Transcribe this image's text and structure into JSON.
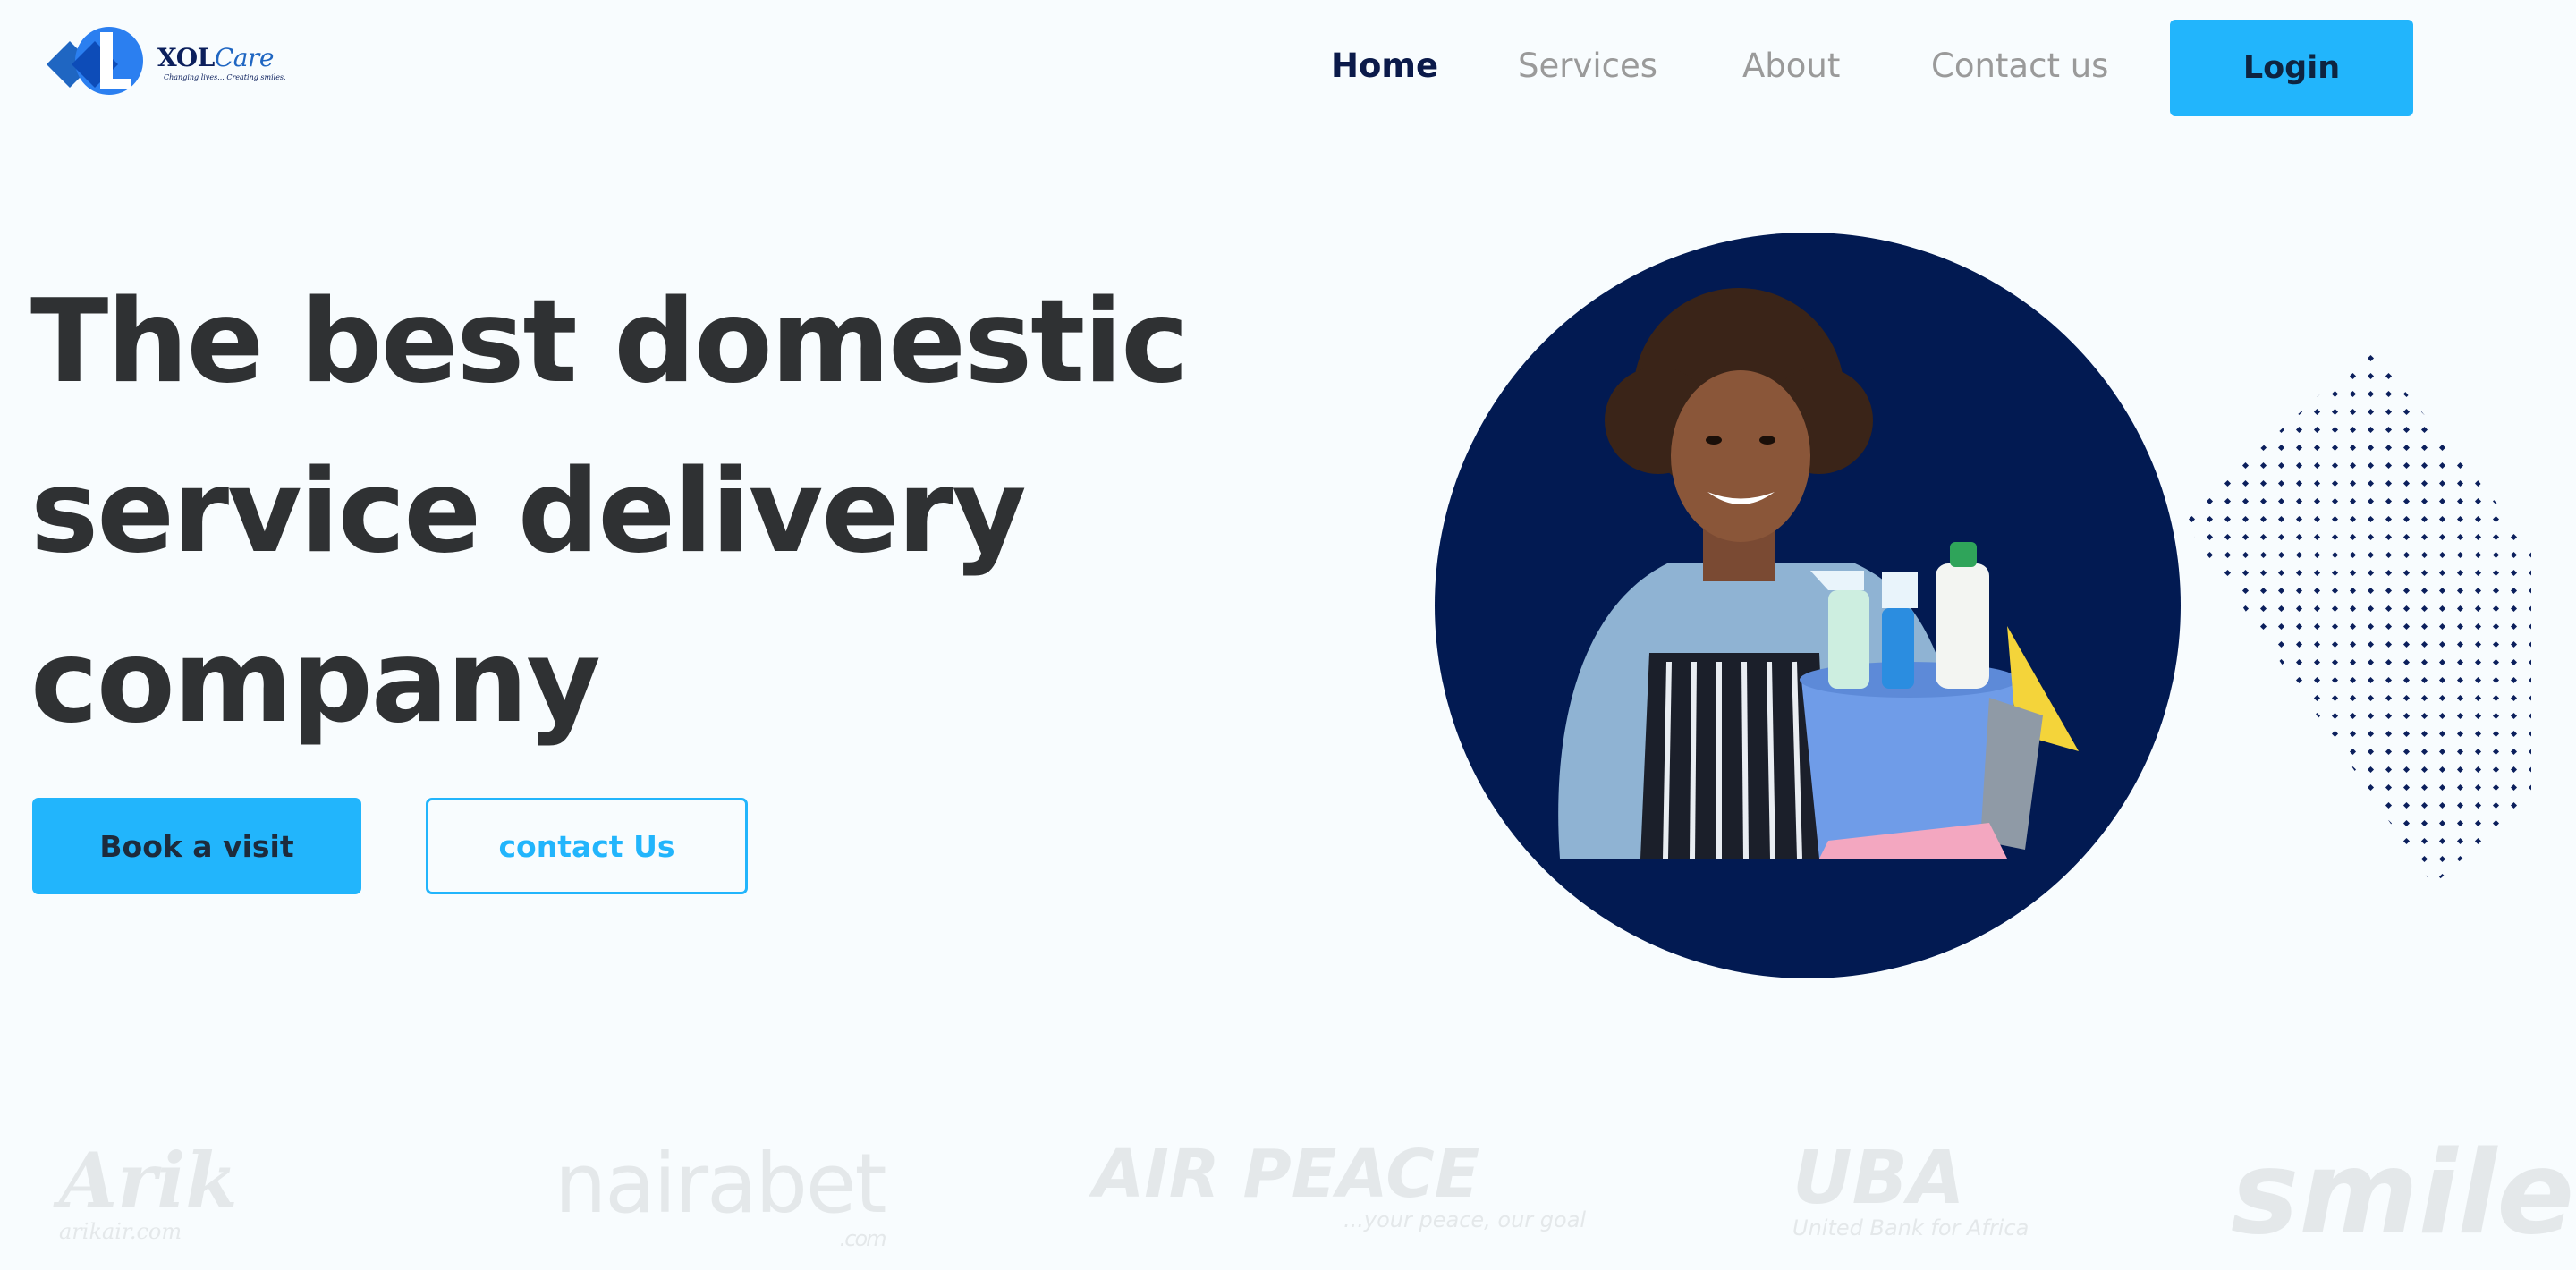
{
  "brand": {
    "name_main": "XOL",
    "name_accent": "Care",
    "tagline": "Changing lives... Creating smiles."
  },
  "nav": {
    "items": [
      "Home",
      "Services",
      "About",
      "Contact us"
    ],
    "active": "Home",
    "login_label": "Login"
  },
  "hero": {
    "title": "The best domestic service delivery company",
    "primary_button": "Book a visit",
    "secondary_button": "contact Us"
  },
  "partners": [
    {
      "name": "Arik",
      "sub": "arikair.com"
    },
    {
      "name": "nairabet",
      "sub": ".com"
    },
    {
      "name": "AIR PEACE",
      "sub": "...your peace, our goal"
    },
    {
      "name": "UBA",
      "sub": "United Bank for Africa"
    },
    {
      "name": "smile",
      "sub": ""
    }
  ],
  "colors": {
    "accent": "#22b5fc",
    "navy": "#021a52",
    "heading": "#2f3133",
    "nav_inactive": "#9a9a9a",
    "background": "#f8fcfe"
  }
}
